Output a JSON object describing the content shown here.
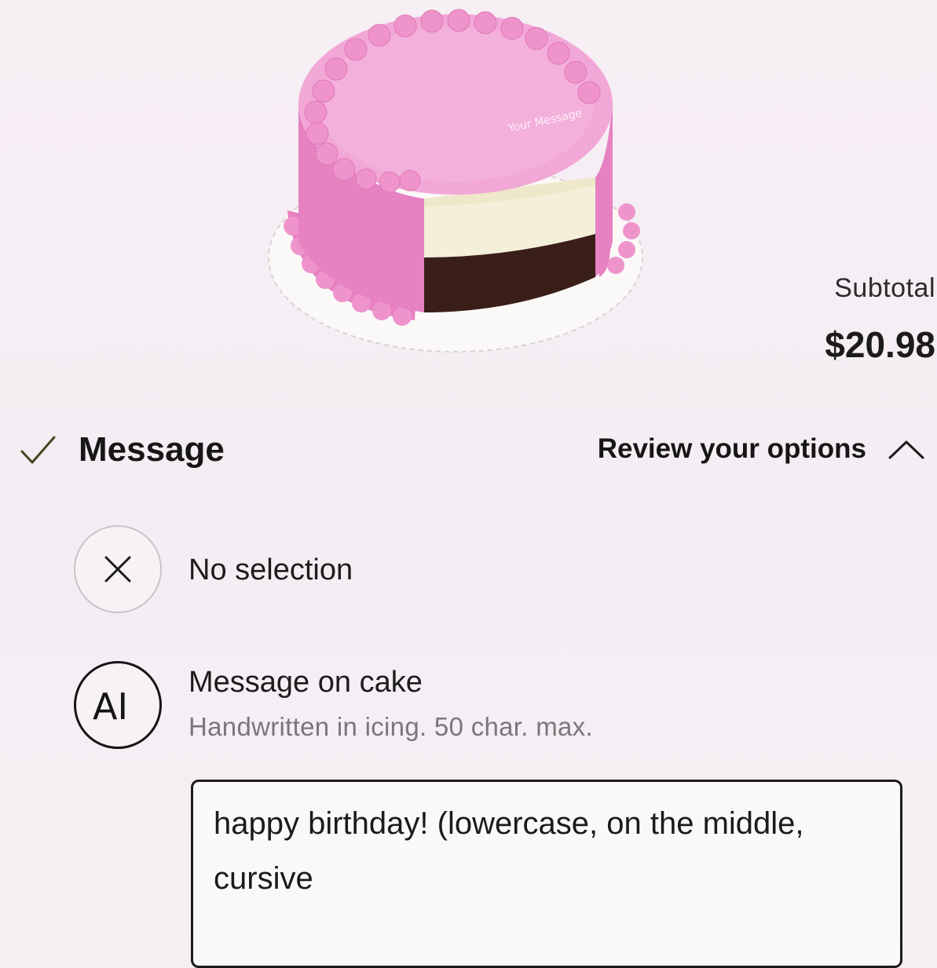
{
  "product": {
    "image_icon": "pink-cake-image",
    "cake_top_text": "Your Message"
  },
  "summary": {
    "subtotal_label": "Subtotal",
    "subtotal_value": "$20.98"
  },
  "message_section": {
    "title": "Message",
    "title_icon": "check-icon",
    "review_label": "Review your options",
    "review_icon": "chevron-up-icon",
    "options": [
      {
        "icon": "close-icon",
        "label": "No selection"
      },
      {
        "icon": "text-input-icon",
        "icon_text": "AI",
        "label": "Message on cake",
        "description": "Handwritten in icing. 50 char. max."
      }
    ],
    "message_value": "happy birthday! (lowercase, on the middle, cursive"
  },
  "colors": {
    "background": "#f5eef3",
    "check": "#3f4a1e",
    "cake_pink": "#e98bc6",
    "cake_top": "#f3a9d8",
    "sponge": "#f4efd8",
    "chocolate": "#3a1f19"
  }
}
